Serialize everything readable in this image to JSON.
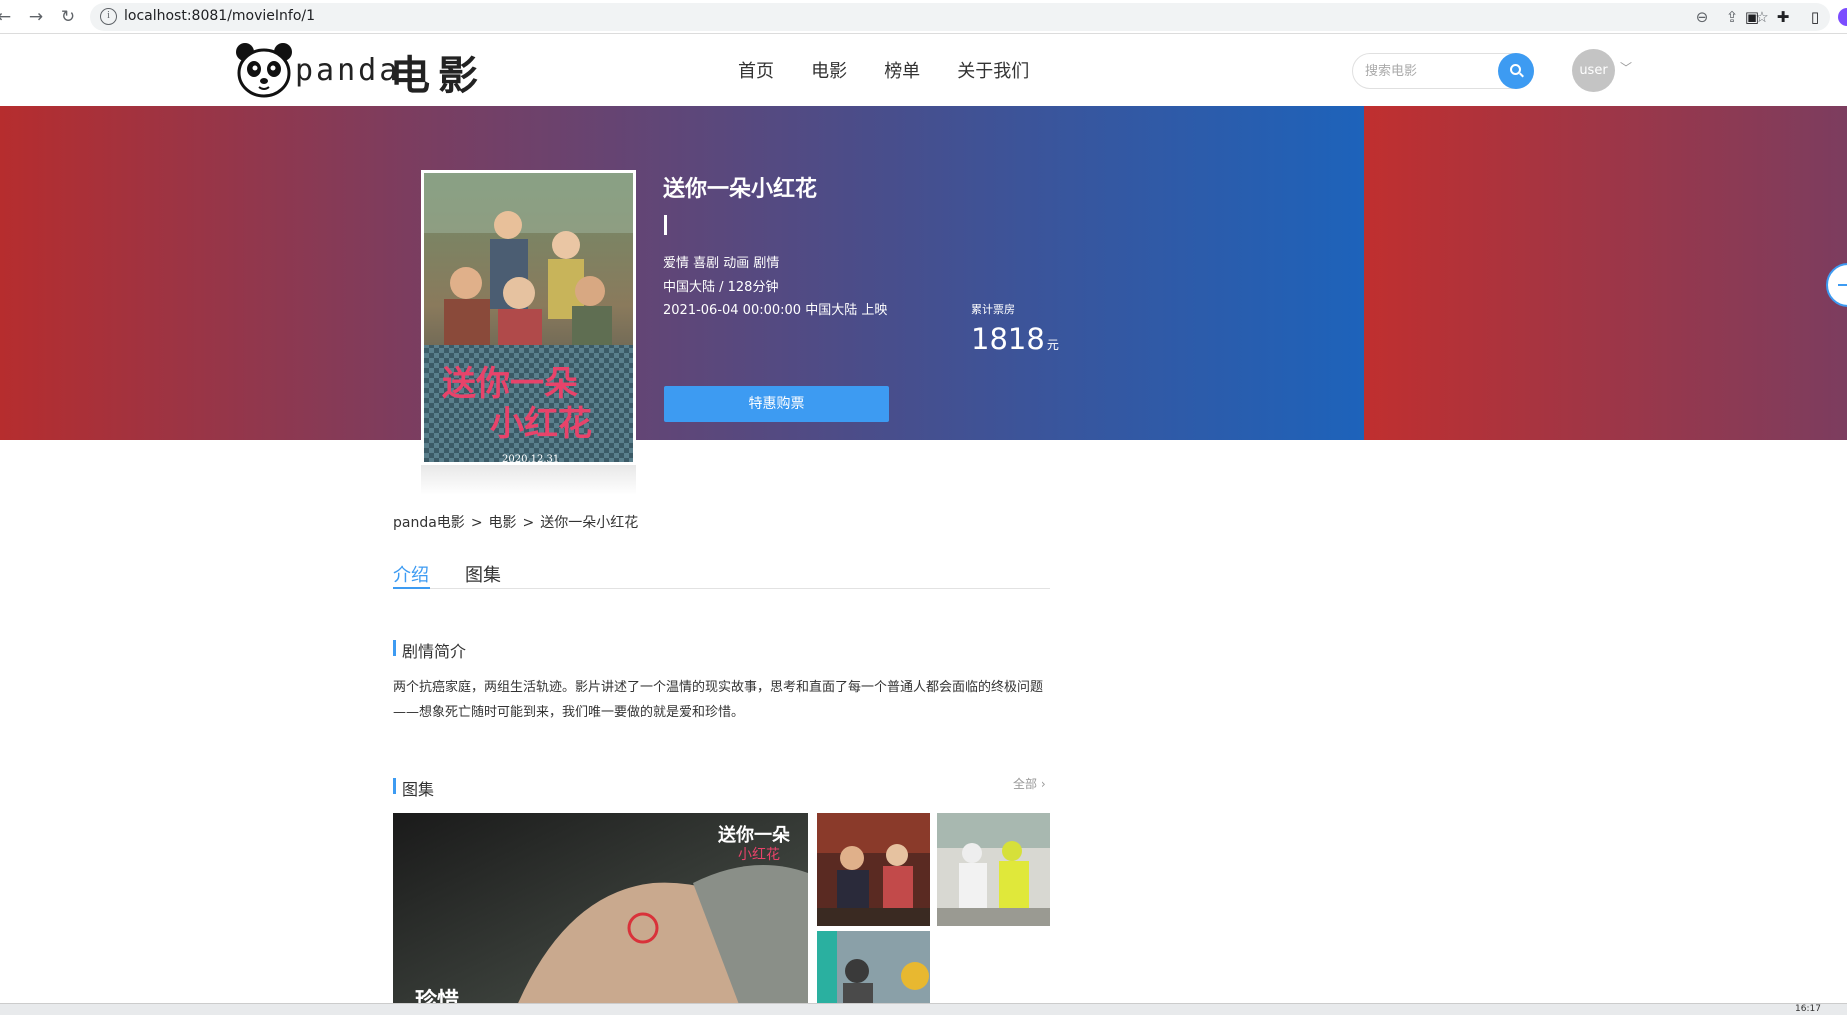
{
  "browser": {
    "url": "localhost:8081/movieInfo/1",
    "back_icon": "arrow-left-icon",
    "forward_icon": "arrow-right-icon",
    "reload_icon": "reload-icon"
  },
  "header": {
    "logo_text": "panda",
    "logo_cn": "电影",
    "nav": [
      "首页",
      "电影",
      "榜单",
      "关于我们"
    ],
    "search_placeholder": "搜索电影",
    "avatar_label": "user"
  },
  "movie": {
    "title": "送你一朵小红花",
    "genres": "爱情 喜剧 动画 剧情",
    "meta": "中国大陆 / 128分钟",
    "release": "2021-06-04 00:00:00 中国大陆 上映",
    "box_office_label": "累计票房",
    "box_office_value": "1818",
    "box_office_unit": "元",
    "buy_button": "特惠购票",
    "poster_date": "2020.12.31"
  },
  "breadcrumb": [
    "panda电影",
    "电影",
    "送你一朵小红花"
  ],
  "tabs": [
    "介绍",
    "图集"
  ],
  "synopsis": {
    "heading": "剧情简介",
    "text": "两个抗癌家庭，两组生活轨迹。影片讲述了一个温情的现实故事，思考和直面了每一个普通人都会面临的终极问题——想象死亡随时可能到来，我们唯一要做的就是爱和珍惜。"
  },
  "gallery": {
    "heading": "图集",
    "all_link": "全部",
    "main_caption": "珍惜"
  },
  "taskbar": {
    "clock": "16:17"
  },
  "colors": {
    "accent": "#3d9bf2"
  }
}
